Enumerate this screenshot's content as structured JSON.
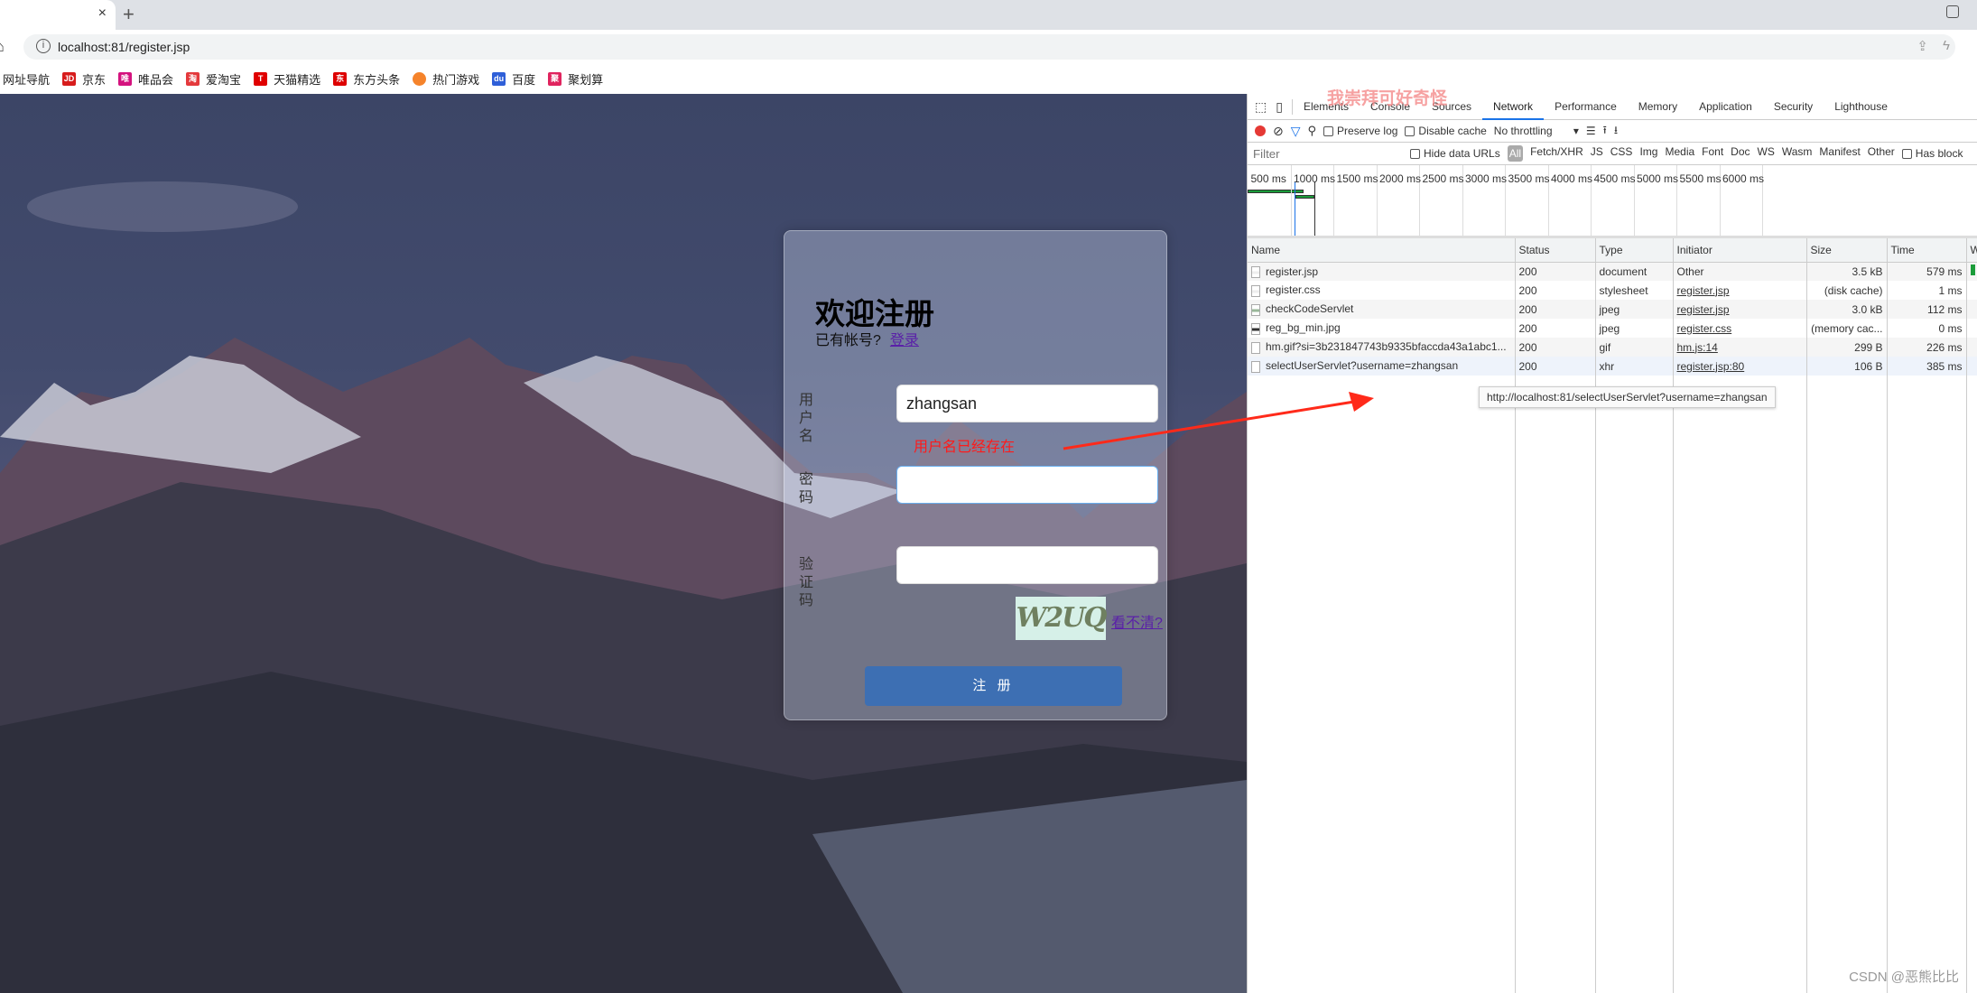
{
  "browser": {
    "tab_close": "×",
    "new_tab": "+",
    "url": "localhost:81/register.jsp",
    "bookmarks": [
      {
        "label": "网址导航",
        "icon": "",
        "color": ""
      },
      {
        "label": "京东",
        "icon": "JD",
        "color": "#d71c1c"
      },
      {
        "label": "唯品会",
        "icon": "唯",
        "color": "#d4127e"
      },
      {
        "label": "爱淘宝",
        "icon": "淘",
        "color": "#e4393c"
      },
      {
        "label": "天猫精选",
        "icon": "T",
        "color": "#e00000"
      },
      {
        "label": "东方头条",
        "icon": "东方",
        "color": "#d00"
      },
      {
        "label": "热门游戏",
        "icon": "",
        "color": "#f5832b"
      },
      {
        "label": "百度",
        "icon": "du",
        "color": "#2f5fd8"
      },
      {
        "label": "聚划算",
        "icon": "聚",
        "color": "#e0245e"
      }
    ]
  },
  "form": {
    "title": "欢迎注册",
    "has_account": "已有帐号?",
    "login_link": "登录",
    "username_label": "用户名",
    "username_value": "zhangsan",
    "error": "用户名已经存在",
    "password_label": "密码",
    "code_label": "验证码",
    "captcha_text": "W2UQ",
    "change_link": "看不清?",
    "submit": "注 册"
  },
  "devtools": {
    "tabs": [
      "Elements",
      "Console",
      "Sources",
      "Network",
      "Performance",
      "Memory",
      "Application",
      "Security",
      "Lighthouse"
    ],
    "active_tab": "Network",
    "toolbar": {
      "preserve_log": "Preserve log",
      "disable_cache": "Disable cache",
      "throttling": "No throttling"
    },
    "filter": {
      "placeholder": "Filter",
      "hide_data_urls": "Hide data URLs",
      "types": [
        "All",
        "Fetch/XHR",
        "JS",
        "CSS",
        "Img",
        "Media",
        "Font",
        "Doc",
        "WS",
        "Wasm",
        "Manifest",
        "Other"
      ],
      "has_blocked": "Has block"
    },
    "timeline_ticks": [
      "500 ms",
      "1000 ms",
      "1500 ms",
      "2000 ms",
      "2500 ms",
      "3000 ms",
      "3500 ms",
      "4000 ms",
      "4500 ms",
      "5000 ms",
      "5500 ms",
      "6000 ms"
    ],
    "columns": [
      "Name",
      "Status",
      "Type",
      "Initiator",
      "Size",
      "Time",
      "W"
    ],
    "rows": [
      {
        "name": "register.jsp",
        "status": "200",
        "type": "document",
        "initiator": "Other",
        "size": "3.5 kB",
        "time": "579 ms"
      },
      {
        "name": "register.css",
        "status": "200",
        "type": "stylesheet",
        "initiator": "register.jsp",
        "size": "(disk cache)",
        "time": "1 ms"
      },
      {
        "name": "checkCodeServlet",
        "status": "200",
        "type": "jpeg",
        "initiator": "register.jsp",
        "size": "3.0 kB",
        "time": "112 ms"
      },
      {
        "name": "reg_bg_min.jpg",
        "status": "200",
        "type": "jpeg",
        "initiator": "register.css",
        "size": "(memory cac...",
        "time": "0 ms"
      },
      {
        "name": "hm.gif?si=3b231847743b9335bfaccda43a1abc1...",
        "status": "200",
        "type": "gif",
        "initiator": "hm.js:14",
        "size": "299 B",
        "time": "226 ms"
      },
      {
        "name": "selectUserServlet?username=zhangsan",
        "status": "200",
        "type": "xhr",
        "initiator": "register.jsp:80",
        "size": "106 B",
        "time": "385 ms"
      }
    ],
    "tooltip": "http://localhost:81/selectUserServlet?username=zhangsan"
  },
  "annotation": {
    "overlay_text": "我崇拜可好奇怪",
    "arrow_color": "#ff2a1a"
  },
  "watermark": "CSDN @恶熊比比"
}
